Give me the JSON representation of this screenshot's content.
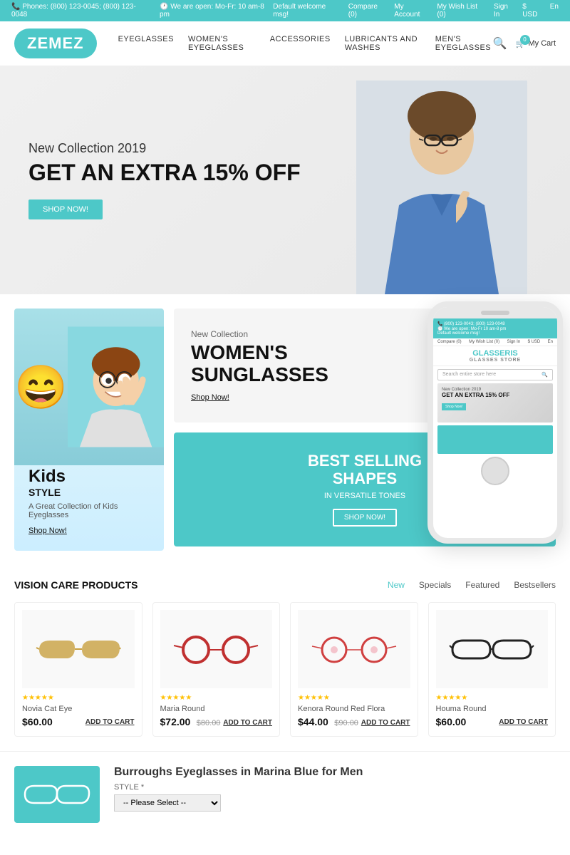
{
  "topbar": {
    "phone_label": "Phones:",
    "phone_numbers": "(800) 123-0045; (800) 123-0048",
    "hours_label": "We are open: Mo-Fr: 10 am-8 pm",
    "compare": "Compare (0)",
    "account": "My Account",
    "wishlist": "My Wish List (0)",
    "signin": "Sign In",
    "currency": "$ USD",
    "lang": "En"
  },
  "header": {
    "logo": "ZEMEZ",
    "nav": [
      {
        "label": "EYEGLASSES"
      },
      {
        "label": "WOMEN'S EYEGLASSES"
      },
      {
        "label": "ACCESSORIES"
      },
      {
        "label": "LUBRICANTS AND WASHES"
      },
      {
        "label": "MEN'S EYEGLASSES"
      }
    ],
    "cart": "My Cart",
    "cart_count": "0"
  },
  "hero": {
    "subtitle": "New Collection 2019",
    "title": "GET AN EXTRA 15% OFF",
    "cta": "Shop Now!"
  },
  "tiles": {
    "kids": {
      "label": "Kids",
      "title": "STYLE",
      "desc": "A Great Collection of Kids Eyeglasses",
      "link": "Shop Now!"
    },
    "womens": {
      "label": "New Collection",
      "title": "WOMEN'S SUNGLASSES",
      "link": "Shop Now!"
    },
    "bestselling": {
      "title": "BEST SELLING SHAPES",
      "subtitle": "IN VERSATILE TONES",
      "link": "Shop Now!"
    }
  },
  "phone_mockup": {
    "search_placeholder": "Search entire store here",
    "logo": "GLASSERIS",
    "tagline": "GLASSES STORE",
    "hero_subtitle": "New Collection 2019",
    "hero_title": "GET AN EXTRA 15% OFF",
    "hero_btn": "Shop Now!"
  },
  "products": {
    "section_title": "VISION CARE PRODUCTS",
    "tabs": [
      {
        "label": "New",
        "active": true
      },
      {
        "label": "Specials",
        "active": false
      },
      {
        "label": "Featured",
        "active": false
      },
      {
        "label": "Bestsellers",
        "active": false
      }
    ],
    "items": [
      {
        "name": "Novia Cat Eye",
        "price": "$60.00",
        "old_price": "",
        "stars": "★★★★★",
        "add_label": "ADD TO CART",
        "color": "#c8a040"
      },
      {
        "name": "Maria Round",
        "price": "$72.00",
        "old_price": "$80.00",
        "stars": "★★★★★",
        "add_label": "ADD TO CART",
        "color": "#c03030"
      },
      {
        "name": "Kenora Round Red Flora",
        "price": "$44.00",
        "old_price": "$90.00",
        "stars": "★★★★★",
        "add_label": "ADD TO CART",
        "color": "#d04040"
      },
      {
        "name": "Houma Round",
        "price": "$60.00",
        "old_price": "",
        "stars": "★★★★★",
        "add_label": "ADD TO CART",
        "color": "#222222"
      }
    ]
  },
  "bottom": {
    "product_title": "Burroughs Eyeglasses in Marina Blue for Men",
    "style_label": "STYLE *",
    "style_placeholder": "-- Please Select --"
  },
  "colors": {
    "accent": "#4dc8c8",
    "text_dark": "#111111",
    "text_medium": "#555555",
    "text_light": "#999999"
  }
}
